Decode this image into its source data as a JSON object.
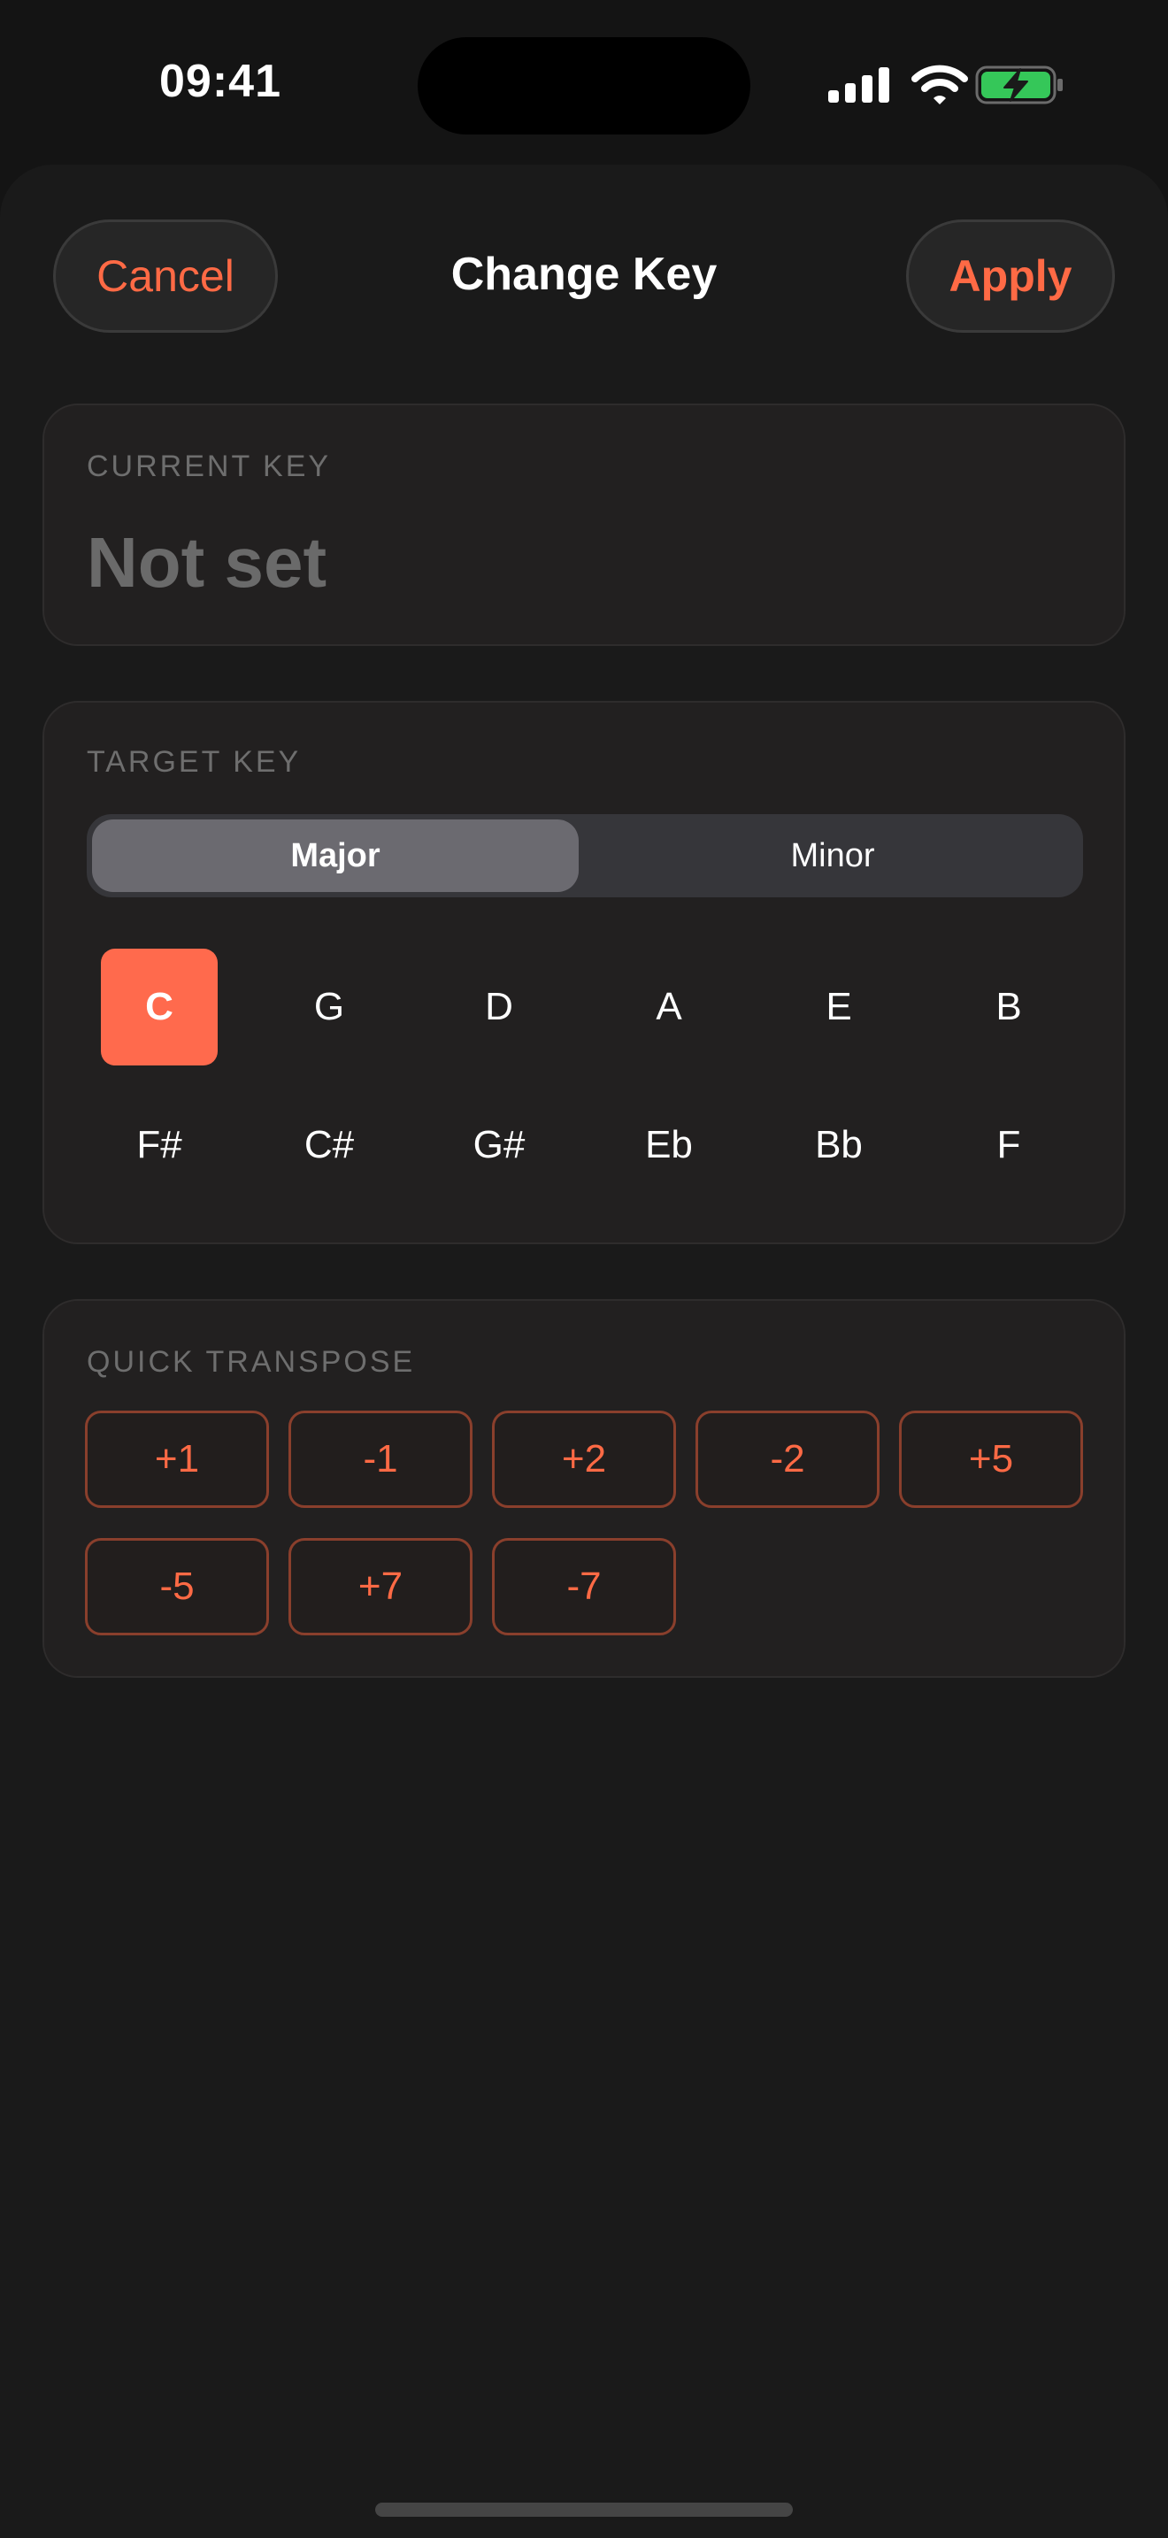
{
  "status_bar": {
    "time": "09:41",
    "icons": [
      "cellular-signal-icon",
      "wifi-icon",
      "battery-charging-icon"
    ],
    "battery_color": "#35c759"
  },
  "header": {
    "cancel_label": "Cancel",
    "title": "Change Key",
    "apply_label": "Apply"
  },
  "current_key": {
    "label": "CURRENT KEY",
    "value": "Not set"
  },
  "target_key": {
    "label": "TARGET KEY",
    "modes": [
      "Major",
      "Minor"
    ],
    "selected_mode": "Major",
    "keys": [
      "C",
      "G",
      "D",
      "A",
      "E",
      "B",
      "F#",
      "C#",
      "G#",
      "Eb",
      "Bb",
      "F"
    ],
    "selected_key": "C"
  },
  "quick_transpose": {
    "label": "QUICK TRANSPOSE",
    "buttons": [
      "+1",
      "-1",
      "+2",
      "-2",
      "+5",
      "-5",
      "+7",
      "-7"
    ]
  },
  "colors": {
    "accent": "#ff6a45",
    "background": "#141414",
    "card": "#222020"
  }
}
